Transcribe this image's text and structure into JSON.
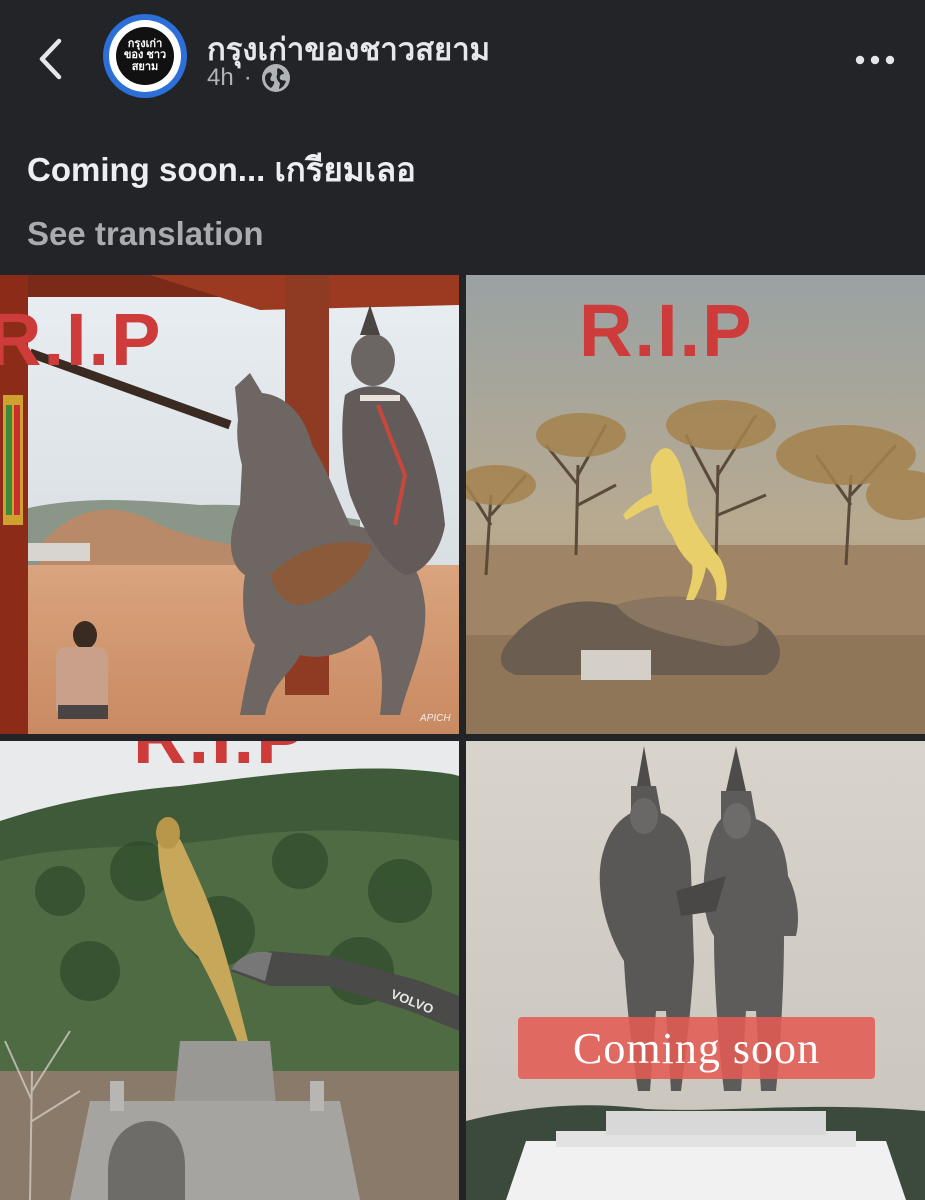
{
  "header": {
    "page_name": "กรุงเก่าของชาวสยาม",
    "time": "4h",
    "separator": "·",
    "avatar_text_top": "กรุงเก่า",
    "avatar_text_mid": "ของ ชาว",
    "avatar_text_bottom": "สยาม",
    "icons": {
      "back": "chevron-left-icon",
      "privacy": "globe-icon",
      "more": "more-horizontal-icon"
    }
  },
  "post": {
    "text": "Coming soon... เกรียมเลอ",
    "see_translation": "See translation"
  },
  "photos": [
    {
      "overlay": "R.I.P",
      "watermark": "APICH"
    },
    {
      "overlay": "R.I.P"
    },
    {
      "overlay": "R.I.P",
      "machine_label": "VOLVO"
    },
    {
      "overlay": "Coming soon"
    }
  ],
  "colors": {
    "background": "#232427",
    "overlay_red": "#cd3b3b",
    "coming_soon_bg": "#e25c54",
    "avatar_ring": "#2d6fd8"
  }
}
